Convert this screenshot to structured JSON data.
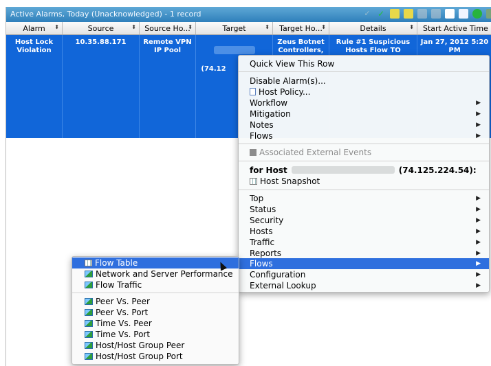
{
  "panel": {
    "title": "Active Alarms, Today (Unacknowledged) - 1 record"
  },
  "columns": [
    "Alarm",
    "Source",
    "Source Ho...",
    "Target",
    "Target Ho...",
    "Details",
    "Start Active Time"
  ],
  "row": {
    "alarm": "Host Lock\nViolation",
    "source": "10.35.88.171",
    "source_host": "Remote VPN\nIP Pool",
    "target": "(74.12",
    "target_host": "Zeus Botnet\nControllers,",
    "details": "Rule #1 Suspicious\nHosts Flow TO",
    "start_time": "Jan 27, 2012 5:20\nPM"
  },
  "context_menu": {
    "quick_view": "Quick View This Row",
    "disable_alarms": "Disable Alarm(s)...",
    "host_policy": "Host Policy...",
    "workflow": "Workflow",
    "mitigation": "Mitigation",
    "notes": "Notes",
    "flows_top": "Flows",
    "associated_events": "Associated External Events",
    "for_host_label": "for Host",
    "host_ip": "(74.125.224.54):",
    "host_snapshot": "Host Snapshot",
    "top": "Top",
    "status": "Status",
    "security": "Security",
    "hosts": "Hosts",
    "traffic": "Traffic",
    "reports": "Reports",
    "flows": "Flows",
    "configuration": "Configuration",
    "external_lookup": "External Lookup"
  },
  "flows_submenu": {
    "flow_table": "Flow Table",
    "network_server_perf": "Network and Server Performance",
    "flow_traffic": "Flow Traffic",
    "peer_vs_peer": "Peer Vs. Peer",
    "peer_vs_port": "Peer Vs. Port",
    "time_vs_peer": "Time Vs. Peer",
    "time_vs_port": "Time Vs. Port",
    "host_group_peer": "Host/Host Group Peer",
    "host_group_port": "Host/Host Group Port"
  },
  "colors": {
    "title_bar": "#2f7fbb",
    "selected_row": "#1166d9",
    "menu_highlight": "#2f6fde"
  }
}
